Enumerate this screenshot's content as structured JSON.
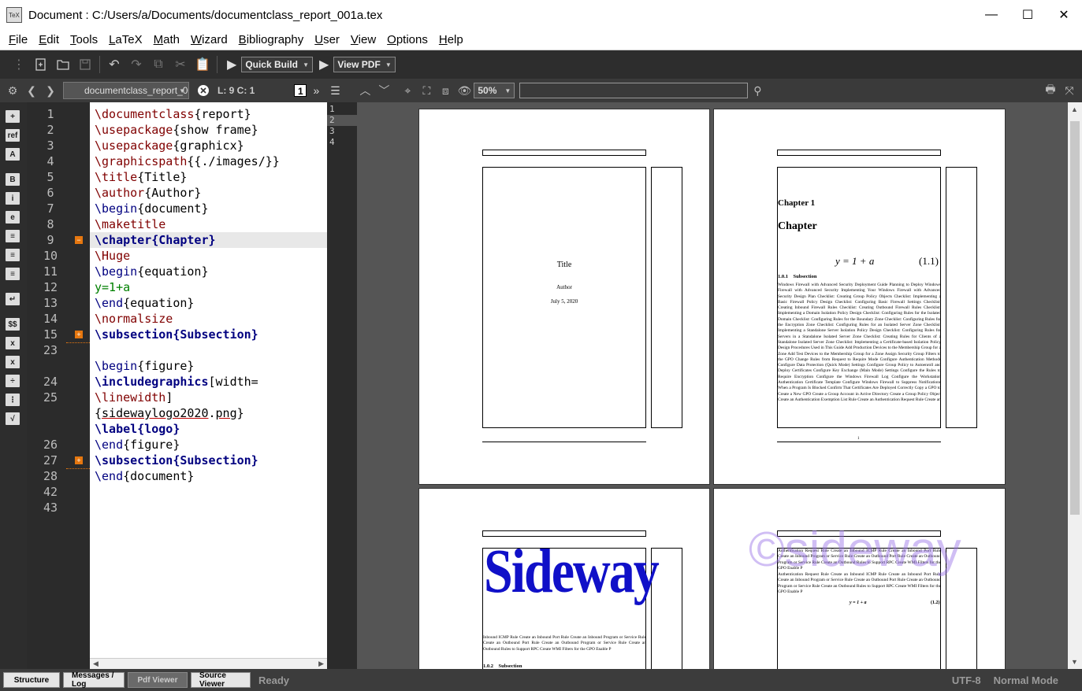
{
  "window": {
    "title": "Document : C:/Users/a/Documents/documentclass_report_001a.tex",
    "app_icon_text": "TeX",
    "controls": {
      "minimize": "—",
      "maximize": "☐",
      "close": "✕"
    }
  },
  "menu": [
    {
      "label": "File",
      "u": "F",
      "rest": "ile"
    },
    {
      "label": "Edit",
      "u": "E",
      "rest": "dit"
    },
    {
      "label": "Tools",
      "u": "T",
      "rest": "ools"
    },
    {
      "label": "LaTeX",
      "u": "L",
      "rest": "aTeX"
    },
    {
      "label": "Math",
      "u": "M",
      "rest": "ath"
    },
    {
      "label": "Wizard",
      "u": "W",
      "rest": "izard"
    },
    {
      "label": "Bibliography",
      "u": "B",
      "rest": "ibliography"
    },
    {
      "label": "User",
      "u": "U",
      "rest": "ser"
    },
    {
      "label": "View",
      "u": "V",
      "rest": "iew"
    },
    {
      "label": "Options",
      "u": "O",
      "rest": "ptions"
    },
    {
      "label": "Help",
      "u": "H",
      "rest": "elp"
    }
  ],
  "toolbar": {
    "build_label": "Quick Build",
    "view_label": "View PDF"
  },
  "toolbar2": {
    "file_combo": "documentclass_report_001a.tex",
    "cursor_pos": "L: 9 C: 1",
    "page_num": "1",
    "zoom": "50%",
    "search_value": ""
  },
  "left_icons": [
    "+",
    "ref",
    "A",
    "B",
    "i",
    "e",
    "≡",
    "≡",
    "≡",
    "↵",
    "$$",
    "x",
    "x",
    "÷",
    "⋮",
    "√"
  ],
  "editor": {
    "line_numbers": [
      "1",
      "2",
      "3",
      "4",
      "5",
      "6",
      "7",
      "8",
      "9",
      "10",
      "11",
      "12",
      "13",
      "14",
      "15",
      "23",
      "",
      "24",
      "25",
      "",
      "",
      "26",
      "27",
      "28",
      "42",
      "43"
    ],
    "lines": [
      [
        {
          "c": "kw",
          "t": "\\documentclass"
        },
        {
          "c": "",
          "t": "{report}"
        }
      ],
      [
        {
          "c": "kw",
          "t": "\\usepackage"
        },
        {
          "c": "",
          "t": "{show frame}"
        }
      ],
      [
        {
          "c": "kw",
          "t": "\\usepackage"
        },
        {
          "c": "",
          "t": "{graphicx}"
        }
      ],
      [
        {
          "c": "kw",
          "t": "\\graphicspath"
        },
        {
          "c": "",
          "t": "{{./images/}}"
        }
      ],
      [
        {
          "c": "kw",
          "t": "\\title"
        },
        {
          "c": "",
          "t": "{Title}"
        }
      ],
      [
        {
          "c": "kw",
          "t": "\\author"
        },
        {
          "c": "",
          "t": "{Author}"
        }
      ],
      [
        {
          "c": "kwb",
          "t": "\\begin"
        },
        {
          "c": "",
          "t": "{document}"
        }
      ],
      [
        {
          "c": "kw",
          "t": "\\maketitle"
        }
      ],
      [
        {
          "c": "kwbb",
          "t": "\\chapter{Chapter}"
        }
      ],
      [
        {
          "c": "kw",
          "t": "\\Huge"
        }
      ],
      [
        {
          "c": "kwb",
          "t": "\\begin"
        },
        {
          "c": "",
          "t": "{equation}"
        }
      ],
      [
        {
          "c": "grn",
          "t": "y=1+a"
        }
      ],
      [
        {
          "c": "kwb",
          "t": "\\end"
        },
        {
          "c": "",
          "t": "{equation}"
        }
      ],
      [
        {
          "c": "kw",
          "t": "\\normalsize"
        }
      ],
      [
        {
          "c": "kwbb",
          "t": "\\subsection{Subsection}"
        }
      ],
      [],
      [
        {
          "c": "kwb",
          "t": "\\begin"
        },
        {
          "c": "",
          "t": "{figure}"
        }
      ],
      [
        {
          "c": "kwbb",
          "t": "\\includegraphics"
        },
        {
          "c": "",
          "t": "[width="
        }
      ],
      [
        {
          "c": "kw",
          "t": "\\linewidth"
        },
        {
          "c": "",
          "t": "]"
        }
      ],
      [
        {
          "c": "",
          "t": "{"
        },
        {
          "c": "ul",
          "t": "sidewaylogo2020"
        },
        {
          "c": "",
          "t": "."
        },
        {
          "c": "ul",
          "t": "png"
        },
        {
          "c": "",
          "t": "}"
        }
      ],
      [
        {
          "c": "kwbb",
          "t": "\\label{logo}"
        }
      ],
      [
        {
          "c": "kwb",
          "t": "\\end"
        },
        {
          "c": "",
          "t": "{figure}"
        }
      ],
      [
        {
          "c": "kwbb",
          "t": "\\subsection{Subsection}"
        }
      ],
      [
        {
          "c": "kwb",
          "t": "\\end"
        },
        {
          "c": "",
          "t": "{document}"
        }
      ],
      []
    ],
    "line_rows": [
      0,
      1,
      2,
      3,
      4,
      5,
      6,
      7,
      8,
      9,
      10,
      11,
      12,
      13,
      14,
      15,
      16,
      17,
      18,
      19,
      20,
      21,
      22,
      23,
      24,
      25
    ],
    "fold_minus": "−",
    "fold_plus": "+"
  },
  "structure_lines": [
    "1",
    "2",
    "3",
    "4"
  ],
  "pdf": {
    "page1": {
      "title": "Title",
      "author": "Author",
      "date": "July 5, 2020"
    },
    "page2": {
      "chapter_num": "Chapter 1",
      "chapter_title": "Chapter",
      "equation": "y = 1 + a",
      "eq_num": "(1.1)",
      "subsection": "1.0.1    Subsection",
      "body": "Windows Firewall with Advanced Security Deployment Guide Planning to Deploy Windows Firewall with Advanced Security Implementing Your Windows Firewall with Advanced Security Design Plan Checklist: Creating Group Policy Objects Checklist: Implementing a Basic Firewall Policy Design Checklist: Configuring Basic Firewall Settings Checklist: Creating Inbound Firewall Rules Checklist: Creating Outbound Firewall Rules Checklist: Implementing a Domain Isolation Policy Design Checklist: Configuring Rules for the Isolated Domain Checklist: Configuring Rules for the Boundary Zone Checklist: Configuring Rules for the Encryption Zone Checklist: Configuring Rules for an Isolated Server Zone Checklist: Implementing a Standalone Server Isolation Policy Design Checklist: Configuring Rules for Servers in a Standalone Isolated Server Zone Checklist: Creating Rules for Clients of a Standalone Isolated Server Zone Checklist: Implementing a Certificate-based Isolation Policy Design Procedures Used in This Guide Add Production Devices to the Membership Group for a Zone Add Test Devices to the Membership Group for a Zone Assign Security Group Filters to the GPO Change Rules from Request to Require Mode Configure Authentication Methods Configure Data Protection (Quick Mode) Settings Configure Group Policy to Autoenroll and Deploy Certificates Configure Key Exchange (Main Mode) Settings Configure the Rules to Require Encryption Configure the Windows Firewall Log Configure the Workstation Authentication Certificate Template Configure Windows Firewall to Suppress Notifications When a Program Is Blocked Confirm That Certificates Are Deployed Correctly Copy a GPO to Create a New GPO Create a Group Account in Active Directory Create a Group Policy Object Create an Authentication Exemption List Rule Create an Authentication Request Rule Create an",
      "page_num": "1"
    },
    "page3": {
      "logo": "Sideway",
      "body": "Inbound ICMP Rule Create an Inbound Port Rule Create an Inbound Program or Service Rule Create an Outbound Port Rule Create an Outbound Program or Service Rule Create an Outbound Rules to Support RPC Create WMI Filters for the GPO Enable P",
      "subsection": "1.0.2    Subsection"
    },
    "page4": {
      "body1": "Authentication Request Rule Create an Inbound ICMP Rule Create an Inbound Port Rule Create an Inbound Program or Service Rule Create an Outbound Port Rule Create an Outbound Program or Service Rule Create an Outbound Rules to Support RPC Create WMI Filters for the GPO Enable P",
      "body2": "Authentication Request Rule Create an Inbound ICMP Rule Create an Inbound Port Rule Create an Inbound Program or Service Rule Create an Outbound Port Rule Create an Outbound Program or Service Rule Create an Outbound Rules to Support RPC Create WMI Filters for the GPO Enable P",
      "equation": "y = 1 + a",
      "eq_num": "(1.2)",
      "watermark": "©sideway"
    }
  },
  "status": {
    "tabs": [
      "Structure",
      "Messages / Log",
      "Pdf Viewer",
      "Source Viewer"
    ],
    "message": "Ready",
    "encoding": "UTF-8",
    "mode": "Normal Mode"
  },
  "colors": {
    "fold_accent": "#e6770f",
    "keyword": "#800000",
    "command": "#000080",
    "math": "#008000"
  }
}
